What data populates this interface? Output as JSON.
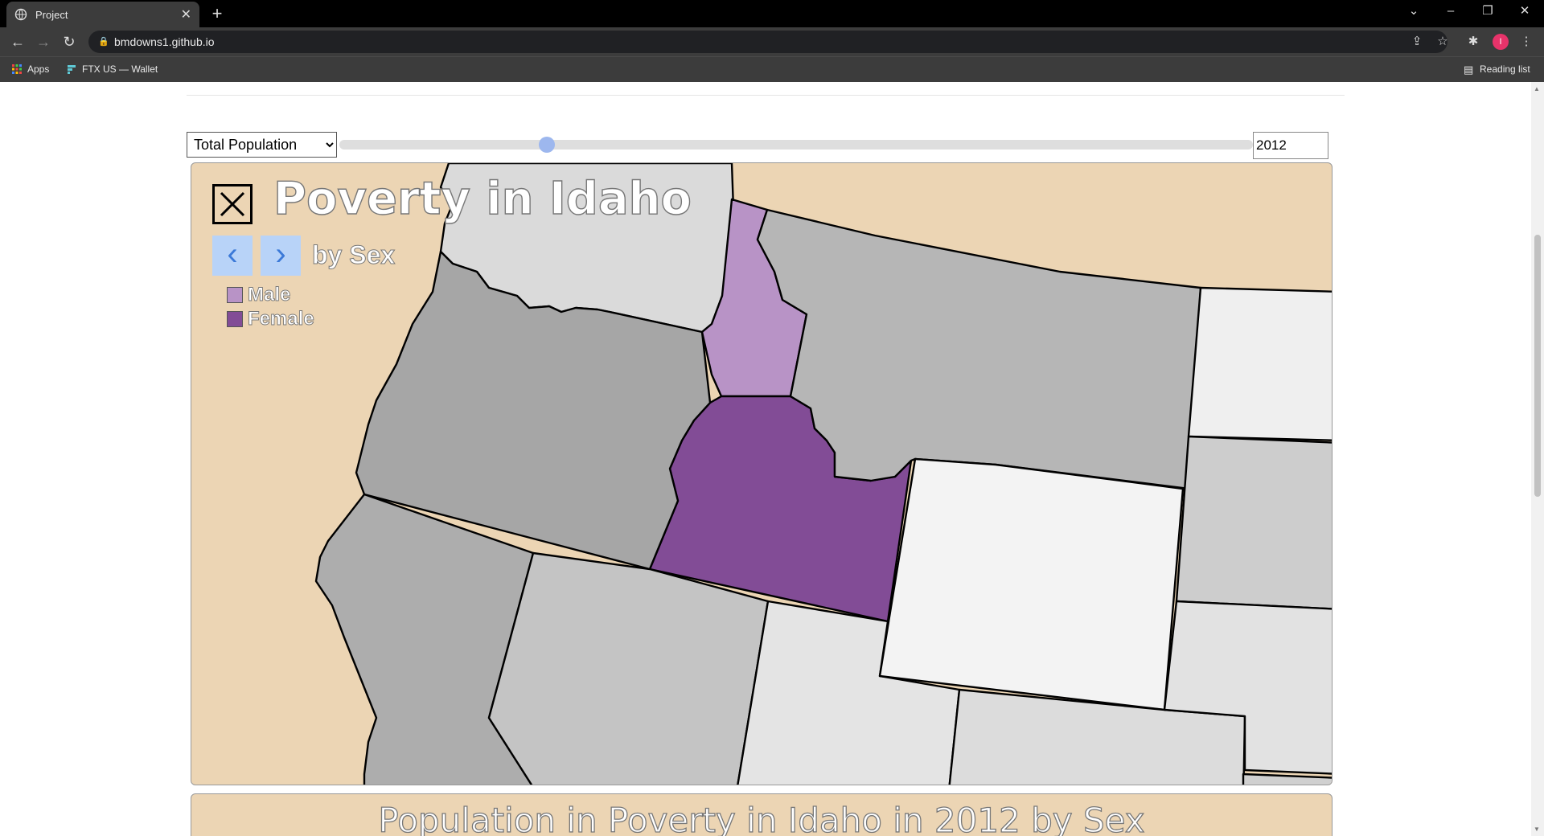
{
  "browser": {
    "tab_title": "Project",
    "url": "bmdowns1.github.io",
    "bookmarks": [
      "Apps",
      "FTX US — Wallet"
    ],
    "reading_list": "Reading list",
    "profile_initial": "I"
  },
  "controls": {
    "metric_selected": "Total Population",
    "metric_options": [
      "Total Population"
    ],
    "year_value": "2012",
    "slider_position": 0.227
  },
  "map": {
    "title": "Poverty in Idaho",
    "subtitle": "by Sex",
    "prev_icon": "chevron-left-icon",
    "next_icon": "chevron-right-icon",
    "close_icon": "close-icon",
    "legend": [
      {
        "label": "Male",
        "color": "#b893c6"
      },
      {
        "label": "Female",
        "color": "#824c96"
      }
    ],
    "background_color": "#ecd5b4"
  },
  "chart": {
    "title": "Population in Poverty in Idaho in 2012 by Sex"
  }
}
